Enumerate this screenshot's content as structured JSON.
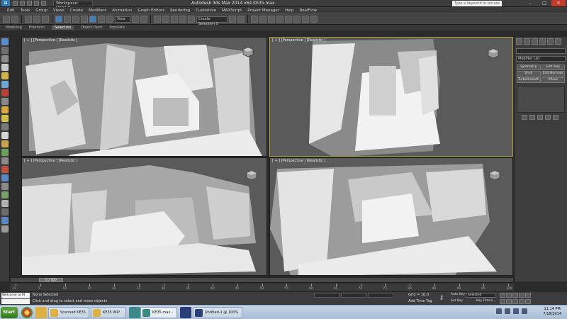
{
  "window": {
    "app_title": "Autodesk 3ds Max  2014 x64    KE35.max",
    "workspace": "Workspace: Default",
    "search_placeholder": "Type a keyword or phrase"
  },
  "menu": [
    "Edit",
    "Tools",
    "Group",
    "Views",
    "Create",
    "Modifiers",
    "Animation",
    "Graph Editors",
    "Rendering",
    "Customize",
    "MAXScript",
    "Project Manager",
    "Help",
    "RealFlow"
  ],
  "toolbar": {
    "view_dropdown": "View",
    "selection_set": "Create Selection S"
  },
  "ribbon": {
    "tabs": [
      "Modeling",
      "Freeform",
      "Selection",
      "Object Paint",
      "Populate"
    ],
    "active": "Selection"
  },
  "viewports": [
    {
      "label": "[ + ] [Perspective ] [Realistic ]"
    },
    {
      "label": "[ + ] [Perspective ] [Realistic ]"
    },
    {
      "label": "[ + ] [Perspective ] [Realistic ]"
    },
    {
      "label": "[ + ] [Perspective ] [Realistic ]"
    }
  ],
  "command_panel": {
    "modifier_list": "Modifier List",
    "buttons": [
      "Symmetry",
      "Edit Poly",
      "Shell",
      "Edit Normals",
      "TurboSmooth",
      "VRoxe"
    ]
  },
  "timeline": {
    "frame_display": "0 / 100",
    "ticks": [
      "0",
      "5",
      "10",
      "15",
      "20",
      "25",
      "30",
      "35",
      "40",
      "45",
      "50",
      "55",
      "60",
      "65",
      "70",
      "75",
      "80",
      "85",
      "90",
      "95",
      "100"
    ]
  },
  "status": {
    "maxscript_text": "Welcome to M",
    "selection": "None Selected",
    "prompt": "Click and drag to select and move objects",
    "grid": "Grid = 10.0",
    "add_time_tag": "Add Time Tag",
    "auto_key": "Auto Key",
    "set_key": "Set Key",
    "key_mode": "Selected",
    "key_filters": "Key Filters..."
  },
  "taskbar": {
    "start": "Start",
    "tasks": [
      {
        "label": "Scanned KE35",
        "color": "#e0b040"
      },
      {
        "label": "KE35 WIP",
        "color": "#e0b040"
      },
      {
        "label": "KE35.max - Autode...",
        "color": "#3a8a8a"
      },
      {
        "label": "Untitled-1 @ 100% (L...",
        "color": "#2a3f7a"
      }
    ],
    "clock_time": "11:14 PM",
    "clock_date": "7/18/2014"
  }
}
